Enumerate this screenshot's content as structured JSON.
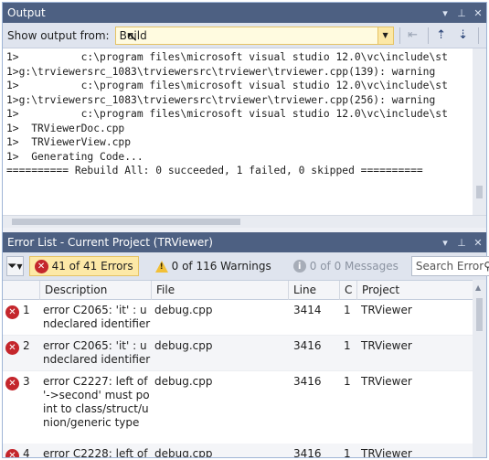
{
  "output_panel": {
    "title": "Output",
    "show_output_from_label": "Show output from:",
    "source_selected": "Build",
    "lines": [
      "1>          c:\\program files\\microsoft visual studio 12.0\\vc\\include\\st",
      "1>g:\\trviewersrc_1083\\trviewersrc\\trviewer\\trviewer.cpp(139): warning ",
      "1>          c:\\program files\\microsoft visual studio 12.0\\vc\\include\\st",
      "1>g:\\trviewersrc_1083\\trviewersrc\\trviewer\\trviewer.cpp(256): warning ",
      "1>          c:\\program files\\microsoft visual studio 12.0\\vc\\include\\st",
      "1>  TRViewerDoc.cpp",
      "1>  TRViewerView.cpp",
      "1>  Generating Code...",
      "========== Rebuild All: 0 succeeded, 1 failed, 0 skipped =========="
    ]
  },
  "error_panel": {
    "title": "Error List - Current Project (TRViewer)",
    "errors_filter": "41 of 41 Errors",
    "warnings_filter": "0 of 116 Warnings",
    "messages_filter": "0 of 0 Messages",
    "search_placeholder": "Search Error",
    "columns": {
      "description": "Description",
      "file": "File",
      "line": "Line",
      "column": "C",
      "project": "Project"
    },
    "rows": [
      {
        "num": "1",
        "description": "error C2065: 'it' : undeclared identifier",
        "file": "debug.cpp",
        "line": "3414",
        "column": "1",
        "project": "TRViewer"
      },
      {
        "num": "2",
        "description": "error C2065: 'it' : undeclared identifier",
        "file": "debug.cpp",
        "line": "3416",
        "column": "1",
        "project": "TRViewer"
      },
      {
        "num": "3",
        "description": "error C2227: left of '->second' must point to class/struct/union/generic type",
        "file": "debug.cpp",
        "line": "3416",
        "column": "1",
        "project": "TRViewer"
      },
      {
        "num": "4",
        "description": "error C2228: left of",
        "file": "debug.cpp",
        "line": "3416",
        "column": "1",
        "project": "TRViewer"
      }
    ]
  },
  "icons": {
    "window_position": "chevron-down-icon",
    "pin": "pin-icon",
    "close": "close-icon",
    "error": "error-circle-icon",
    "warning": "warning-triangle-icon",
    "info": "info-circle-icon",
    "filter": "funnel-icon",
    "search": "search-icon"
  },
  "colors": {
    "title_bar": "#4d6082",
    "combo_background": "#fffbe0",
    "active_filter": "#fde9a7",
    "error_red": "#c4262c",
    "warning_yellow": "#f2c038"
  }
}
